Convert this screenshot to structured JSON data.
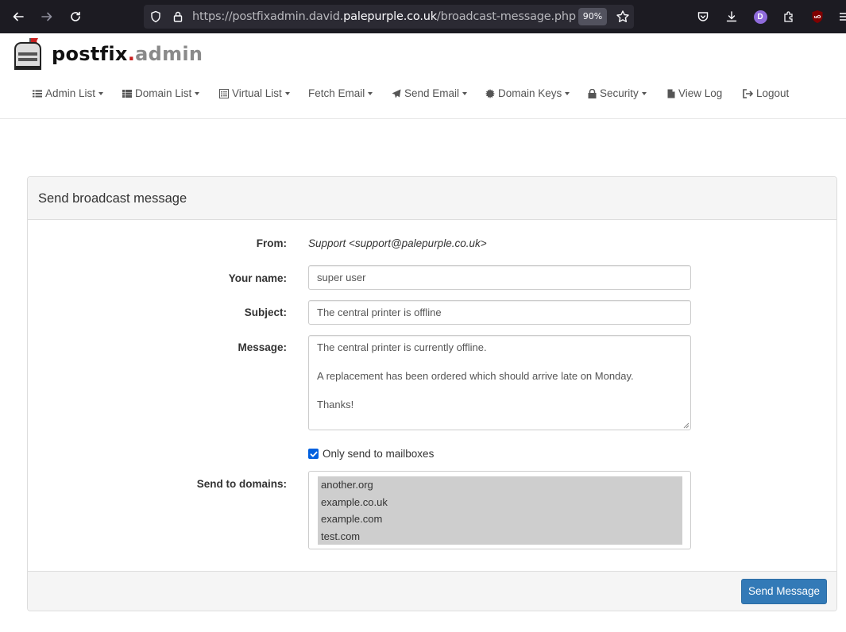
{
  "browser": {
    "url_prefix": "https://postfixadmin.david.",
    "url_host": "palepurple.co.uk",
    "url_path": "/broadcast-message.php",
    "zoom": "90%",
    "profile_initial": "D",
    "accent": "#8f6bdb"
  },
  "app": {
    "logo_part1": "postfix",
    "logo_dot": ".",
    "logo_part2": "admin"
  },
  "nav": {
    "items": [
      {
        "label": "Admin List",
        "icon": "list-icon",
        "dropdown": true
      },
      {
        "label": "Domain List",
        "icon": "th-list-icon",
        "dropdown": true
      },
      {
        "label": "Virtual List",
        "icon": "list-alt-icon",
        "dropdown": true
      },
      {
        "label": "Fetch Email",
        "icon": "",
        "dropdown": true
      },
      {
        "label": "Send Email",
        "icon": "send-icon",
        "dropdown": true
      },
      {
        "label": "Domain Keys",
        "icon": "certificate-icon",
        "dropdown": true
      },
      {
        "label": "Security",
        "icon": "lock-icon",
        "dropdown": true
      },
      {
        "label": "View Log",
        "icon": "file-icon",
        "dropdown": false
      },
      {
        "label": "Logout",
        "icon": "logout-icon",
        "dropdown": false
      }
    ]
  },
  "form": {
    "title": "Send broadcast message",
    "from_label": "From:",
    "from_value": "Support <support@palepurple.co.uk>",
    "name_label": "Your name:",
    "name_value": "super user",
    "subject_label": "Subject:",
    "subject_value": "The central printer is offline",
    "message_label": "Message:",
    "message_lines": [
      "The central printer is currently offline.",
      "",
      "A replacement has been ordered which should arrive late on Monday.",
      "",
      "Thanks!"
    ],
    "mailboxes_only_label": "Only send to mailboxes",
    "mailboxes_only_checked": true,
    "domains_label": "Send to domains:",
    "domains": [
      "another.org",
      "example.co.uk",
      "example.com",
      "test.com"
    ],
    "submit_label": "Send Message",
    "primary_color": "#337ab7"
  }
}
